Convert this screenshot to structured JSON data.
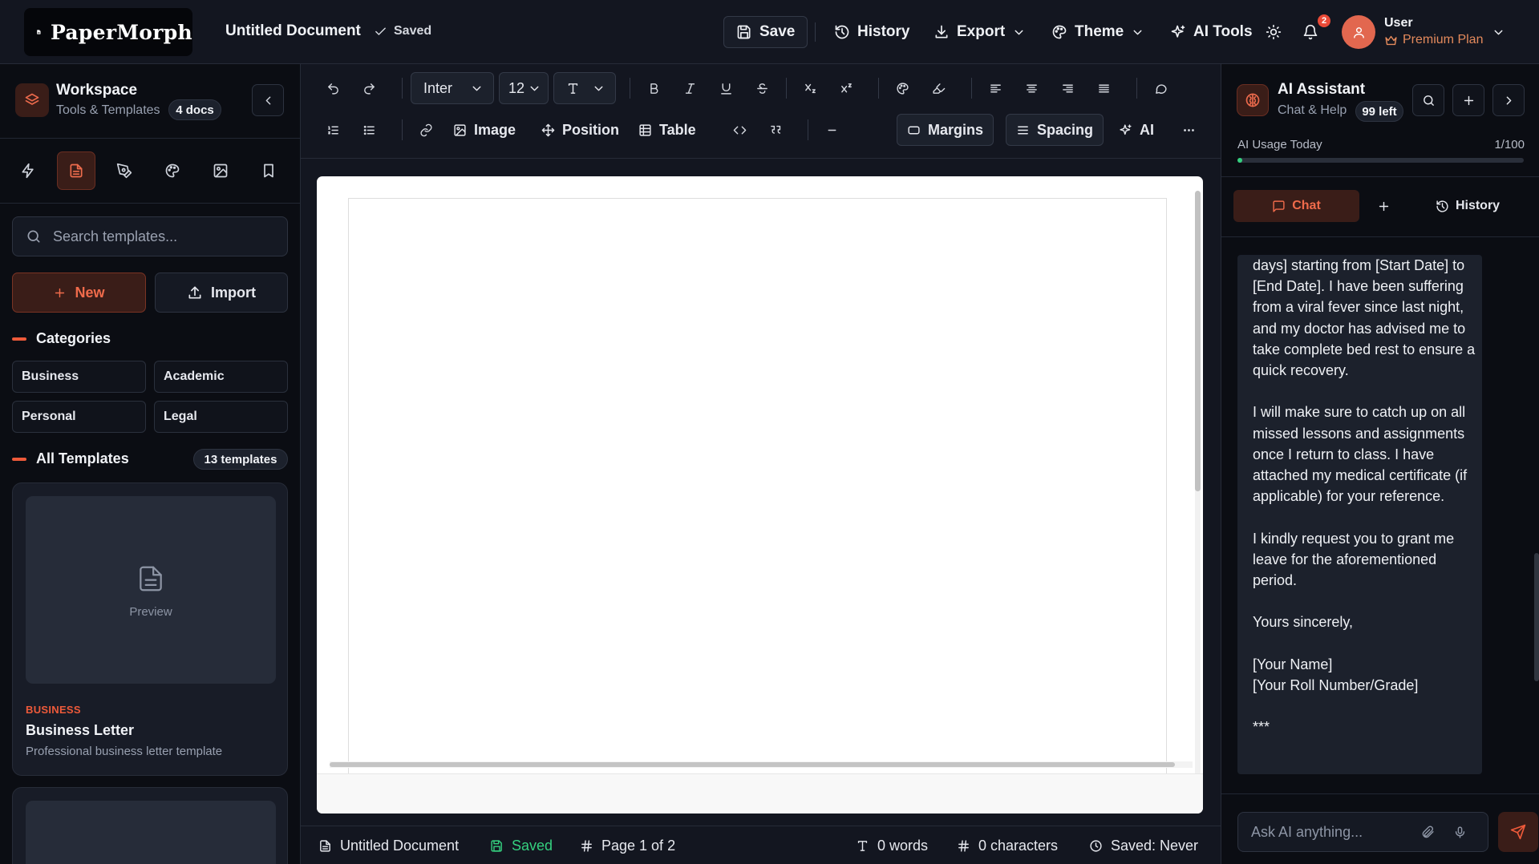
{
  "header": {
    "brand": "PaperMorph",
    "doc_title": "Untitled Document",
    "saved_label": "Saved",
    "save_label": "Save",
    "history_label": "History",
    "export_label": "Export",
    "theme_label": "Theme",
    "ai_tools_label": "AI Tools",
    "notification_count": "2",
    "user_name": "User",
    "user_plan": "Premium Plan"
  },
  "sidebar": {
    "workspace_title": "Workspace",
    "workspace_sub": "Tools & Templates",
    "docs_count": "4 docs",
    "search_placeholder": "Search templates...",
    "new_label": "New",
    "import_label": "Import",
    "categories_title": "Categories",
    "categories": [
      "Business",
      "Academic",
      "Personal",
      "Legal"
    ],
    "all_templates_title": "All Templates",
    "templates_count": "13 templates",
    "templates": [
      {
        "preview": "Preview",
        "category": "BUSINESS",
        "title": "Business Letter",
        "description": "Professional business letter template"
      }
    ]
  },
  "toolbar": {
    "font": "Inter",
    "size": "12",
    "image_label": "Image",
    "position_label": "Position",
    "table_label": "Table",
    "margins_label": "Margins",
    "spacing_label": "Spacing",
    "ai_label": "AI"
  },
  "statusbar": {
    "doc_title": "Untitled Document",
    "saved": "Saved",
    "page": "Page 1 of 2",
    "words": "0 words",
    "characters": "0 characters",
    "last_saved": "Saved: Never"
  },
  "ai": {
    "title": "AI Assistant",
    "sub": "Chat & Help",
    "left": "99 left",
    "usage_label": "AI Usage Today",
    "usage_value": "1/100",
    "usage_fraction": 0.01,
    "chat_tab": "Chat",
    "history_tab": "History",
    "message": "days] starting from [Start Date] to [End Date]. I have been suffering from a viral fever since last night, and my doctor has advised me to take complete bed rest to ensure a quick recovery.\n\nI will make sure to catch up on all missed lessons and assignments once I return to class. I have attached my medical certificate (if applicable) for your reference.\n\nI kindly request you to grant me leave for the aforementioned period.\n\nYours sincerely,\n\n[Your Name]\n[Your Roll Number/Grade]\n\n***",
    "input_placeholder": "Ask AI anything..."
  },
  "colors": {
    "accent": "#ee5a3a",
    "accent_bg": "#3a1d18",
    "success": "#35d07f",
    "background": "#131620",
    "panel": "#0b0d13"
  }
}
